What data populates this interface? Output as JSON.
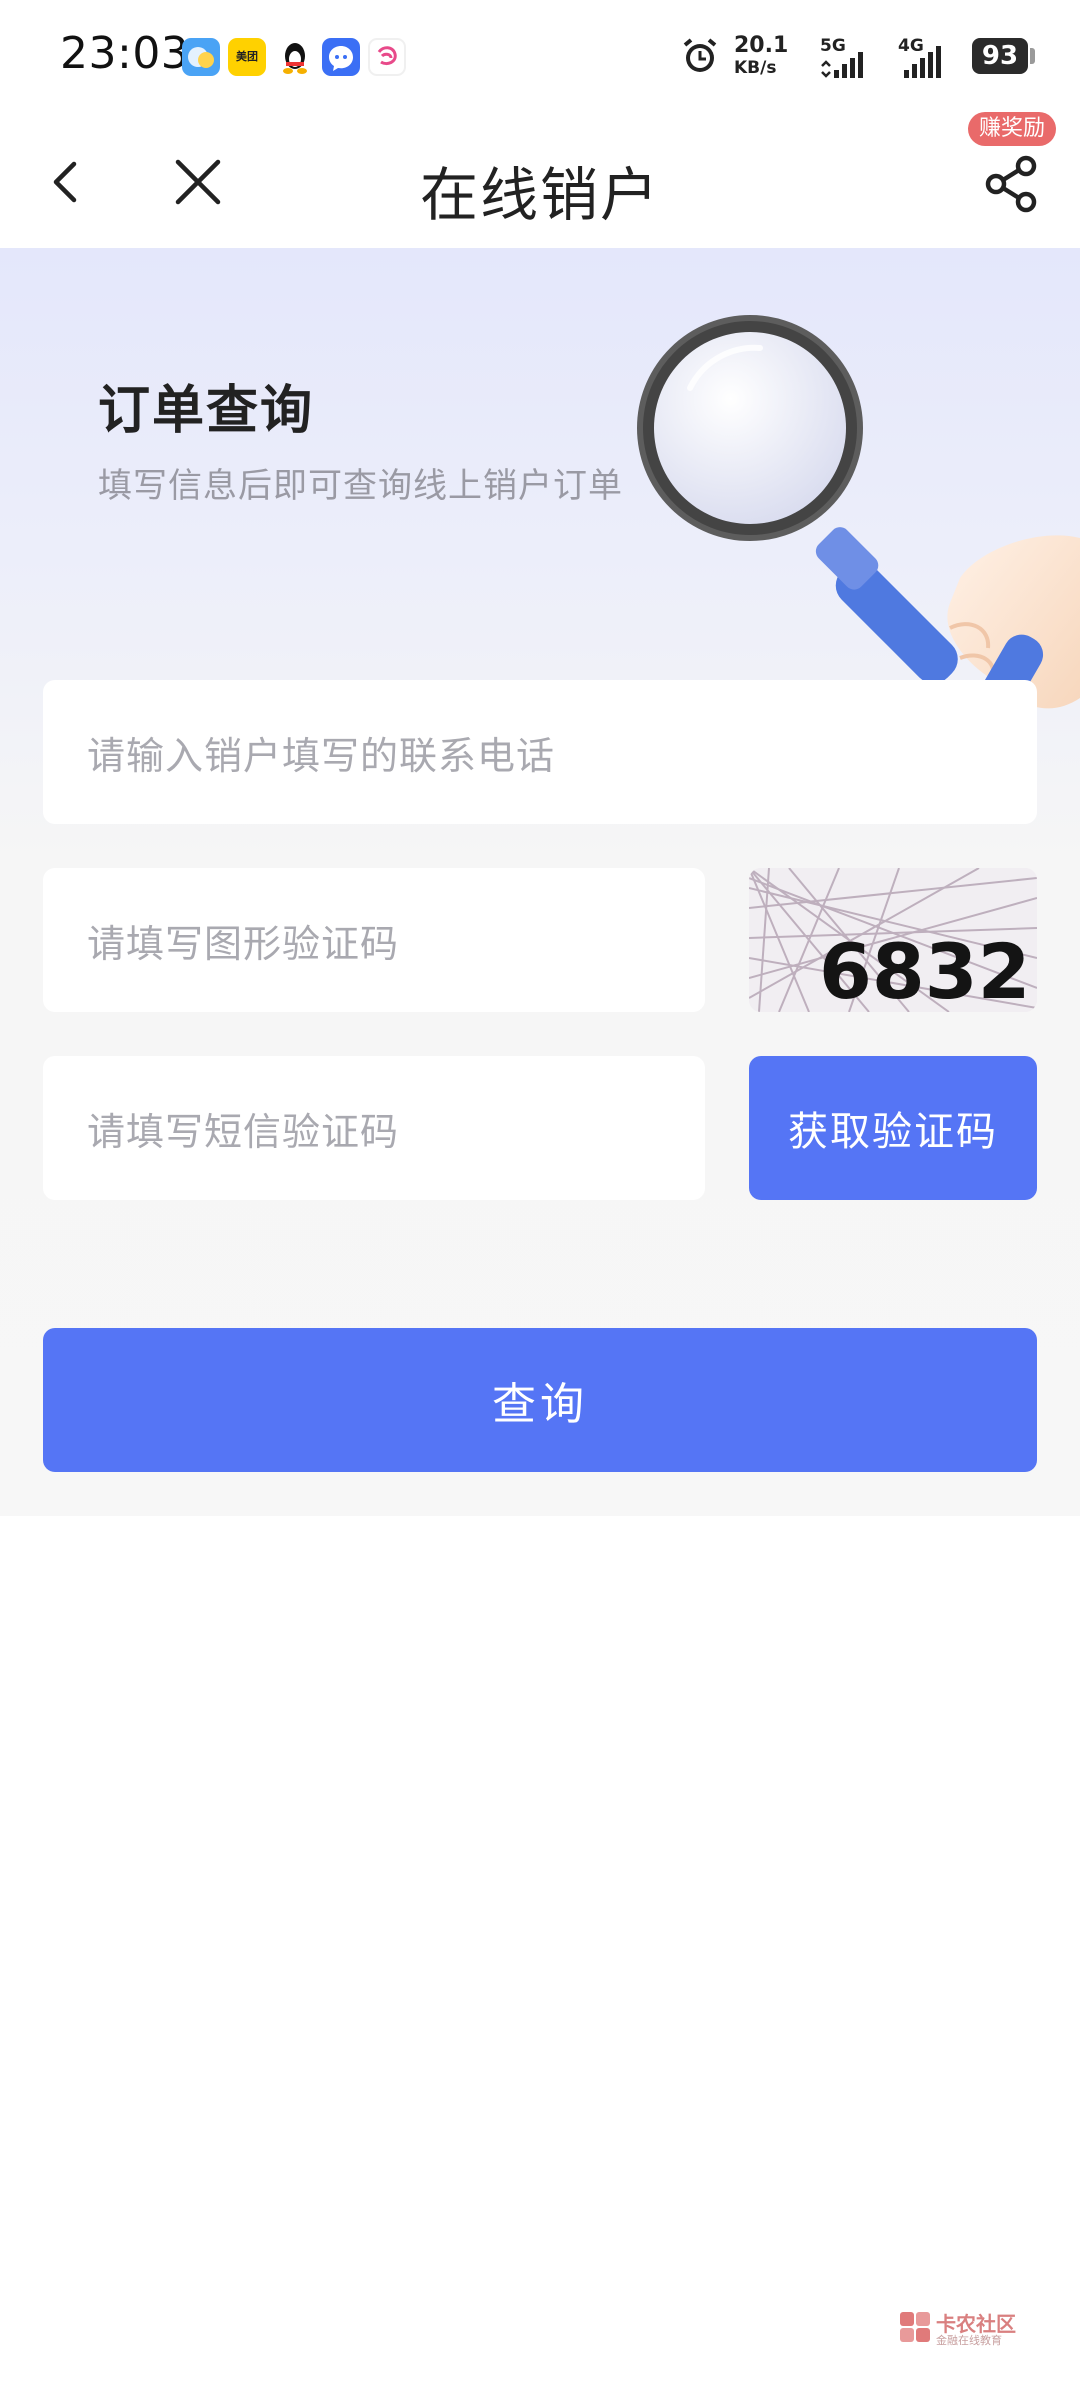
{
  "status_bar": {
    "time": "23:03",
    "notification_icons": [
      "browser-app-icon",
      "meituan-app-icon",
      "qq-penguin-icon",
      "messenger-app-icon",
      "shopping-app-icon"
    ],
    "meituan_label": "美团",
    "net_speed_value": "20.1",
    "net_speed_unit": "KB/s",
    "network_1": "5G",
    "network_2": "4G",
    "battery": "93"
  },
  "nav": {
    "title": "在线销户",
    "reward_badge": "赚奖励"
  },
  "hero": {
    "title": "订单查询",
    "subtitle": "填写信息后即可查询线上销户订单"
  },
  "form": {
    "phone_placeholder": "请输入销户填写的联系电话",
    "captcha_placeholder": "请填写图形验证码",
    "captcha_code": "6832",
    "sms_placeholder": "请填写短信验证码",
    "sms_button": "获取验证码",
    "query_button": "查询"
  },
  "watermark": {
    "name": "卡农社区",
    "tagline": "金融在线教育"
  },
  "colors": {
    "primary": "#5575f5",
    "badge": "#e96a6a",
    "placeholder": "#a9a9b0",
    "hero_bg": "#e4e7fb"
  }
}
